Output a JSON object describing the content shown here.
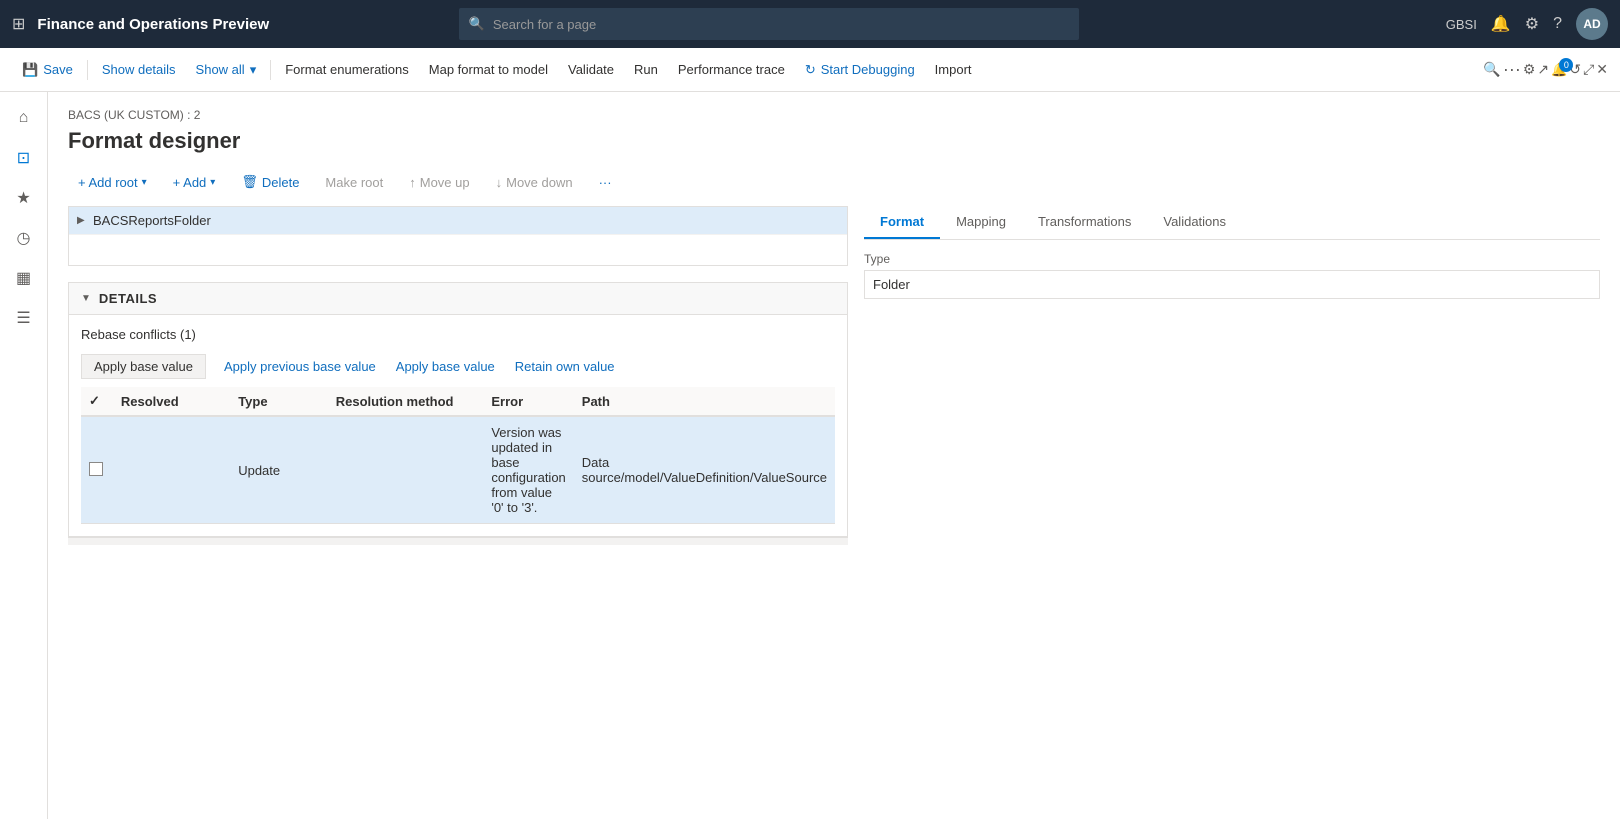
{
  "appTitle": "Finance and Operations Preview",
  "search": {
    "placeholder": "Search for a page"
  },
  "topNav": {
    "userCode": "GBSI",
    "avatarInitials": "AD",
    "notificationCount": "0"
  },
  "toolbar": {
    "save": "Save",
    "showDetails": "Show details",
    "showAll": "Show all",
    "formatEnumerations": "Format enumerations",
    "mapFormatToModel": "Map format to model",
    "validate": "Validate",
    "run": "Run",
    "performanceTrace": "Performance trace",
    "startDebugging": "Start Debugging",
    "import": "Import"
  },
  "breadcrumb": "BACS (UK CUSTOM) : 2",
  "pageTitle": "Format designer",
  "actions": {
    "addRoot": "+ Add root",
    "add": "+ Add",
    "delete": "Delete",
    "makeRoot": "Make root",
    "moveUp": "Move up",
    "moveDown": "Move down"
  },
  "tabs": {
    "format": "Format",
    "mapping": "Mapping",
    "transformations": "Transformations",
    "validations": "Validations"
  },
  "tree": {
    "rootNode": "BACSReportsFolder"
  },
  "typeSection": {
    "label": "Type",
    "value": "Folder"
  },
  "details": {
    "sectionTitle": "DETAILS",
    "rebaseConflictsTitle": "Rebase conflicts (1)",
    "applyPreviousBaseValue": "Apply previous base value",
    "applyBaseValue": "Apply base value",
    "retainOwnValue": "Retain own value"
  },
  "table": {
    "columns": [
      "Resolved",
      "Type",
      "Resolution method",
      "Error",
      "Path"
    ],
    "rows": [
      {
        "resolved": false,
        "type": "Update",
        "resolutionMethod": "",
        "error": "Version was updated in base configuration from value '0' to '3'.",
        "path": "Data source/model/ValueDefinition/ValueSource"
      }
    ]
  }
}
